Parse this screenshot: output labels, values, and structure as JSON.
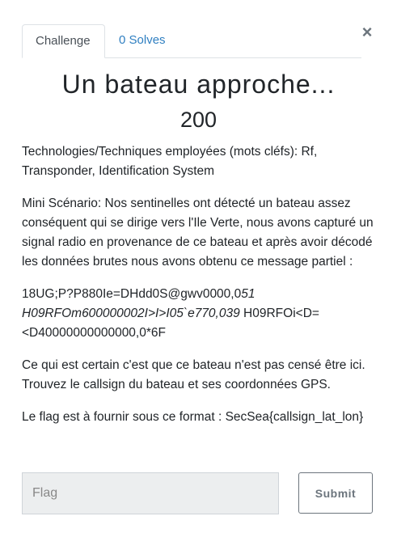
{
  "modal": {
    "close_glyph": "×",
    "tabs": [
      {
        "label": "Challenge",
        "active": true
      },
      {
        "label": "0 Solves",
        "active": false
      }
    ],
    "title": "Un bateau approche...",
    "points": "200",
    "description": {
      "tech": "Technologies/Techniques employées (mots cléfs): Rf, Transponder, Identification System",
      "scenario": "Mini Scénario: Nos sentinelles ont détecté un bateau assez conséquent qui se dirige vers l'Ile Verte, nous avons capturé un signal radio en provenance de ce bateau et après avoir décodé les données brutes nous avons obtenu ce message partiel :",
      "message_part1": "18UG;P?P880Ie=DHdd0S@gwv0000,0",
      "message_italic": "51 H09RFOm600000002I>I>I05`e770,039",
      "message_part2": " H09RFOi<D=<D40000000000000,0*6F",
      "hint": "Ce qui est certain c'est que ce bateau n'est pas censé être ici. Trouvez le callsign du bateau et ses coordonnées GPS.",
      "format": "Le flag est à fournir sous ce format : SecSea{callsign_lat_lon}"
    },
    "form": {
      "flag_placeholder": "Flag",
      "flag_value": "",
      "submit_label": "Submit"
    }
  },
  "colors": {
    "accent": "#2f7fc1",
    "input_bg": "#eceeef",
    "muted": "#6c757d"
  }
}
